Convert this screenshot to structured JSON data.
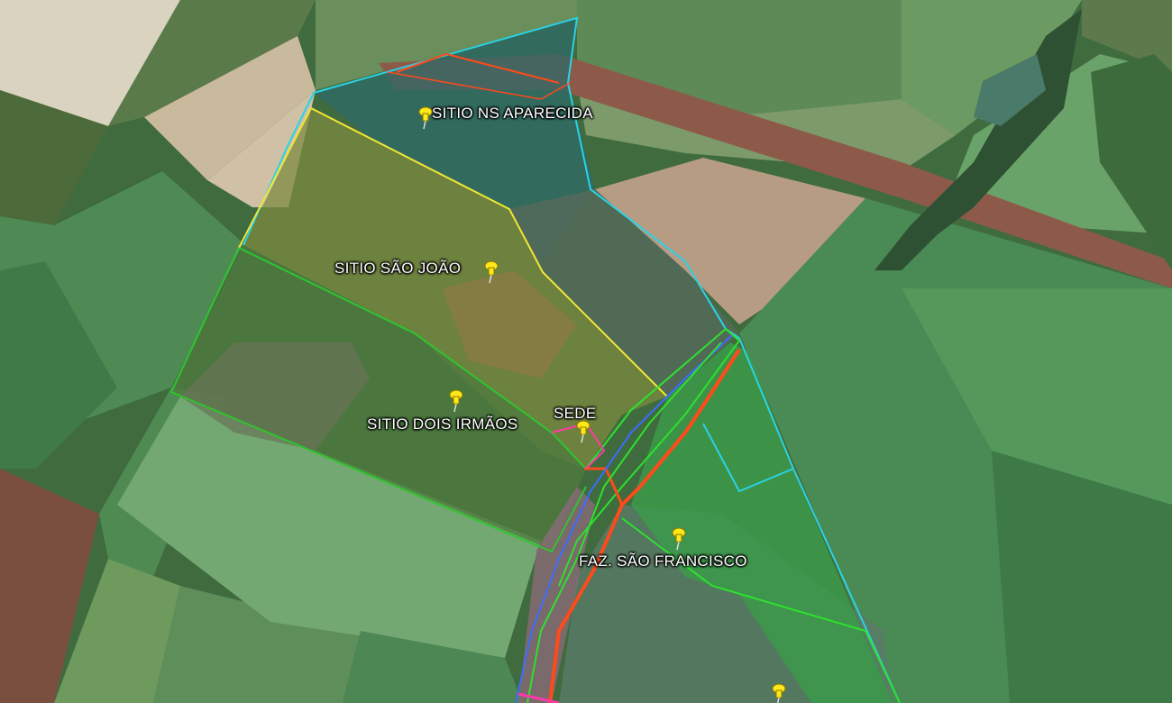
{
  "map": {
    "placemarks": [
      {
        "id": "ns-aparecida",
        "label": "SITIO NS APARECIDA",
        "icon": "yellow-pushpin-icon"
      },
      {
        "id": "sao-joao",
        "label": "SITIO SÃO JOÃO",
        "icon": "yellow-pushpin-icon"
      },
      {
        "id": "dois-irmaos",
        "label": "SITIO DOIS IRMÃOS",
        "icon": "yellow-pushpin-icon"
      },
      {
        "id": "sede",
        "label": "SEDE",
        "icon": "yellow-pushpin-icon"
      },
      {
        "id": "sao-francisco",
        "label": "FAZ. SÃO FRANCISCO",
        "icon": "yellow-pushpin-icon"
      },
      {
        "id": "unlabeled",
        "label": "",
        "icon": "yellow-pushpin-icon"
      }
    ],
    "boundary_colors": {
      "ns_aparecida": "#29d3e6",
      "sao_joao": "#f2e633",
      "dois_irmaos": "#2fc42f",
      "sao_francisco": "#2ee02e",
      "road": "#ff4a1a",
      "river": "#3c6cff",
      "sede": "#ff3aa8"
    }
  }
}
